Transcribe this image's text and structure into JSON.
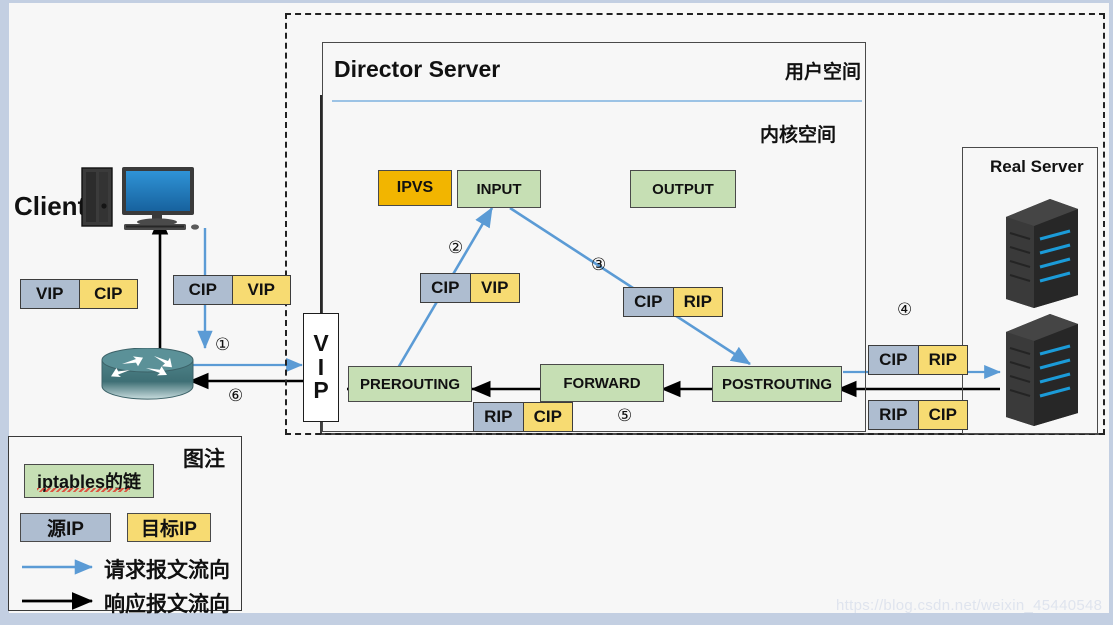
{
  "meta": {
    "watermark": "https://blog.csdn.net/weixin_45440548",
    "colors": {
      "chain_green": "#c6dfb4",
      "ipvs_amber": "#f2b500",
      "src_ip_gray": "#aebdd0",
      "dst_ip_yellow": "#f7db72",
      "request_arrow_blue": "#5b9bd5",
      "response_arrow_black": "#000000",
      "page_background": "#c3cfe2",
      "canvas_background": "#f7f7f7"
    }
  },
  "client": {
    "label": "Client",
    "icon": "desktop-computer-icon",
    "packet_response": {
      "src": "VIP",
      "dst": "CIP"
    },
    "packet_request": {
      "src": "CIP",
      "dst": "VIP"
    }
  },
  "router": {
    "icon": "router-icon"
  },
  "director": {
    "title": "Director Server",
    "user_space": "用户空间",
    "kernel_space": "内核空间",
    "vip_interface": {
      "letters": [
        "V",
        "I",
        "P"
      ],
      "label": "VIP"
    },
    "ipvs": "IPVS",
    "chains": [
      {
        "id": "input",
        "label": "INPUT"
      },
      {
        "id": "output",
        "label": "OUTPUT"
      },
      {
        "id": "prerouting",
        "label": "PREROUTING"
      },
      {
        "id": "forward",
        "label": "FORWARD"
      },
      {
        "id": "postrouting",
        "label": "POSTROUTING"
      }
    ],
    "packet_prerouting_to_input": {
      "src": "CIP",
      "dst": "VIP"
    },
    "packet_input_to_postrouting": {
      "src": "CIP",
      "dst": "RIP"
    },
    "packet_response_return": {
      "src": "RIP",
      "dst": "CIP"
    }
  },
  "real_server": {
    "title": "Real Server",
    "icon": "server-rack-icon",
    "count": 2,
    "packet_request": {
      "src": "CIP",
      "dst": "RIP"
    },
    "packet_response": {
      "src": "RIP",
      "dst": "CIP"
    }
  },
  "steps": [
    {
      "n": "①",
      "name": "client-to-director"
    },
    {
      "n": "②",
      "name": "prerouting-to-input"
    },
    {
      "n": "③",
      "name": "input-to-postrouting"
    },
    {
      "n": "④",
      "name": "director-to-realserver"
    },
    {
      "n": "⑤",
      "name": "realserver-to-director"
    },
    {
      "n": "⑥",
      "name": "director-to-client"
    }
  ],
  "legend": {
    "title": "图注",
    "chain_sample": "iptables的链",
    "src_ip_sample": "源IP",
    "dst_ip_sample": "目标IP",
    "request_flow": "请求报文流向",
    "response_flow": "响应报文流向"
  }
}
